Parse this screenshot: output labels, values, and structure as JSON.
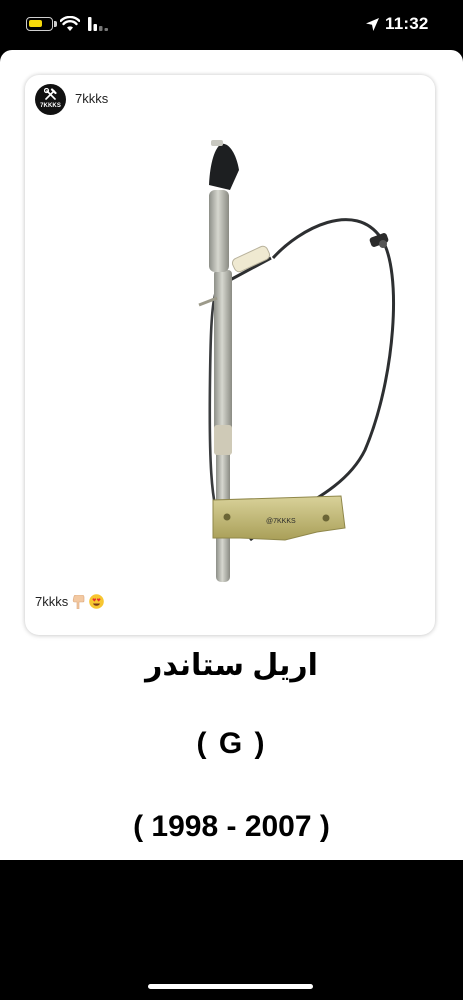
{
  "status_bar": {
    "time": "11:32",
    "battery_level": 0.6,
    "battery_color": "#f5d90a",
    "icons": [
      "battery-icon",
      "wifi-icon",
      "signal-icon",
      "location-arrow-icon"
    ]
  },
  "post": {
    "avatar_text": "7KKKS",
    "account_name": "7kkks",
    "caption_text": "7kkks",
    "caption_emojis": [
      "pointing-down-emoji",
      "heart-eyes-emoji"
    ],
    "image_watermark": "@7KKKS"
  },
  "product": {
    "title": "اريل ستاندر",
    "model": "( G )",
    "years": "( 1998 - 2007 )"
  }
}
